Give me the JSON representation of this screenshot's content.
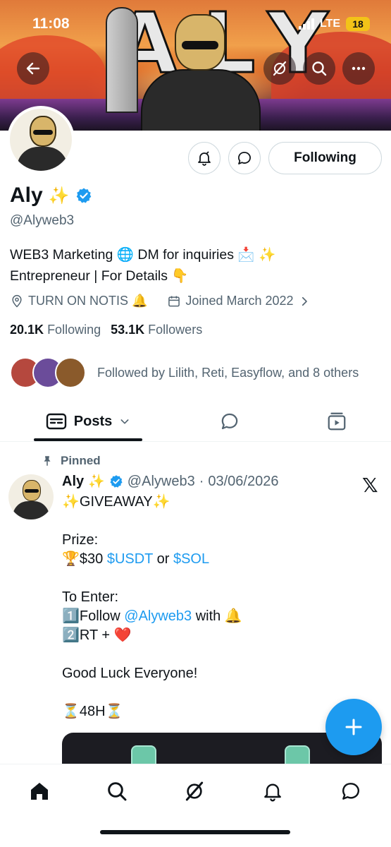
{
  "status_bar": {
    "time": "11:08",
    "network": "LTE",
    "battery": "18"
  },
  "profile": {
    "name": "Aly",
    "name_emoji": "✨",
    "handle": "@Alyweb3",
    "bio_line1": "WEB3 Marketing 🌐 DM for inquiries 📩 ✨",
    "bio_line2": "Entrepreneur | For Details 👇",
    "location": "TURN ON NOTIS 🔔",
    "joined": "Joined March 2022",
    "following_count": "20.1K",
    "following_label": "Following",
    "followers_count": "53.1K",
    "followers_label": "Followers",
    "followed_by": "Followed by Lilith, Reti, Easyflow, and 8 others",
    "follow_button_label": "Following"
  },
  "tabs": {
    "posts_label": "Posts"
  },
  "post": {
    "pinned_label": "Pinned",
    "author_name": "Aly",
    "author_emoji": "✨",
    "author_handle": "@Alyweb3",
    "separator": "·",
    "date": "03/06/2026",
    "line1": "✨GIVEAWAY✨",
    "line2": "Prize:",
    "line3_prefix": "🏆$30 ",
    "line3_link1": "$USDT",
    "line3_mid": " or ",
    "line3_link2": "$SOL",
    "line4": "To Enter:",
    "line5_prefix": "1️⃣Follow ",
    "line5_link": "@Alyweb3",
    "line5_suffix": " with 🔔",
    "line6": "2️⃣RT + ❤️",
    "line7": "Good Luck Everyone!",
    "line8": "⏳48H⏳"
  },
  "colors": {
    "accent": "#1d9bf0",
    "verified": "#1d9bf0",
    "text": "#0f1419",
    "muted": "#536471"
  },
  "icons": [
    "back-arrow-icon",
    "grok-icon",
    "search-icon",
    "more-icon",
    "bell-icon",
    "message-icon",
    "location-icon",
    "calendar-icon",
    "chevron-right-icon",
    "posts-icon",
    "chevron-down-icon",
    "replies-icon",
    "media-icon",
    "pin-icon",
    "verified-icon",
    "x-logo-icon",
    "plus-icon",
    "home-icon",
    "notifications-icon"
  ]
}
